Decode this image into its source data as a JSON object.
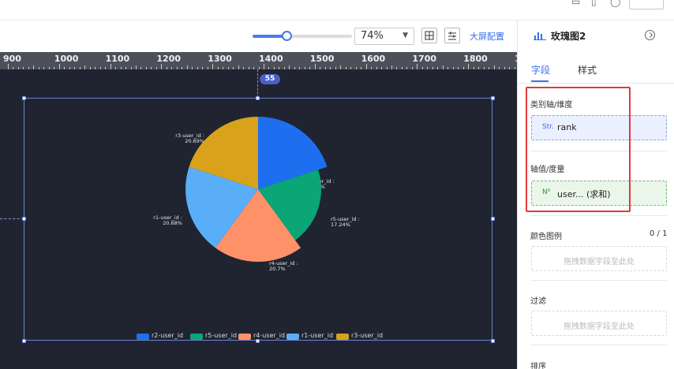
{
  "toolbar": {
    "zoom_value": "74%",
    "zoom_percent": 74,
    "bigscreen_label": "大屏配置"
  },
  "ruler": {
    "labels": [
      "900",
      "1000",
      "1100",
      "1200",
      "1300",
      "1400",
      "1500",
      "1600",
      "1700",
      "1800",
      "19"
    ]
  },
  "canvas": {
    "badge": "55"
  },
  "chart_data": {
    "type": "pie",
    "variant": "rose",
    "slices": [
      {
        "name": "r2-user_id",
        "label": "r2-user_id :",
        "percent_label": "20.69%",
        "value": 20.69,
        "color": "#1e6ff0"
      },
      {
        "name": "r5-user_id",
        "label": "r5-user_id :",
        "percent_label": "17.24%",
        "value": 17.24,
        "color": "#0aa676"
      },
      {
        "name": "r4-user_id",
        "label": "r4-user_id :",
        "percent_label": "20.7%",
        "value": 20.7,
        "color": "#ff9168"
      },
      {
        "name": "r1-user_id",
        "label": "r1-user_id :",
        "percent_label": "20.68%",
        "value": 20.68,
        "color": "#5aaef7"
      },
      {
        "name": "r3-user_id",
        "label": "r3-user_id :",
        "percent_label": "20.69%",
        "value": 20.69,
        "color": "#d8a21a"
      }
    ],
    "legend": [
      "r2-user_id",
      "r5-user_id",
      "r4-user_id",
      "r1-user_id",
      "r3-user_id"
    ],
    "legend_position": "bottom"
  },
  "panel": {
    "title": "玫瑰图2",
    "tabs": [
      {
        "label": "字段",
        "active": true
      },
      {
        "label": "样式",
        "active": false
      }
    ],
    "sections": {
      "category": {
        "label": "类别轴/维度",
        "prefix": "Str.",
        "field": "rank"
      },
      "value": {
        "label": "轴值/度量",
        "prefix": "N⁰",
        "field": "user... (求和)"
      },
      "color": {
        "label": "颜色图例",
        "count": "0 / 1",
        "hint": "拖拽数据字段至此处"
      },
      "filter": {
        "label": "过滤",
        "hint": "拖拽数据字段至此处"
      },
      "sort": {
        "label": "排序"
      }
    }
  }
}
